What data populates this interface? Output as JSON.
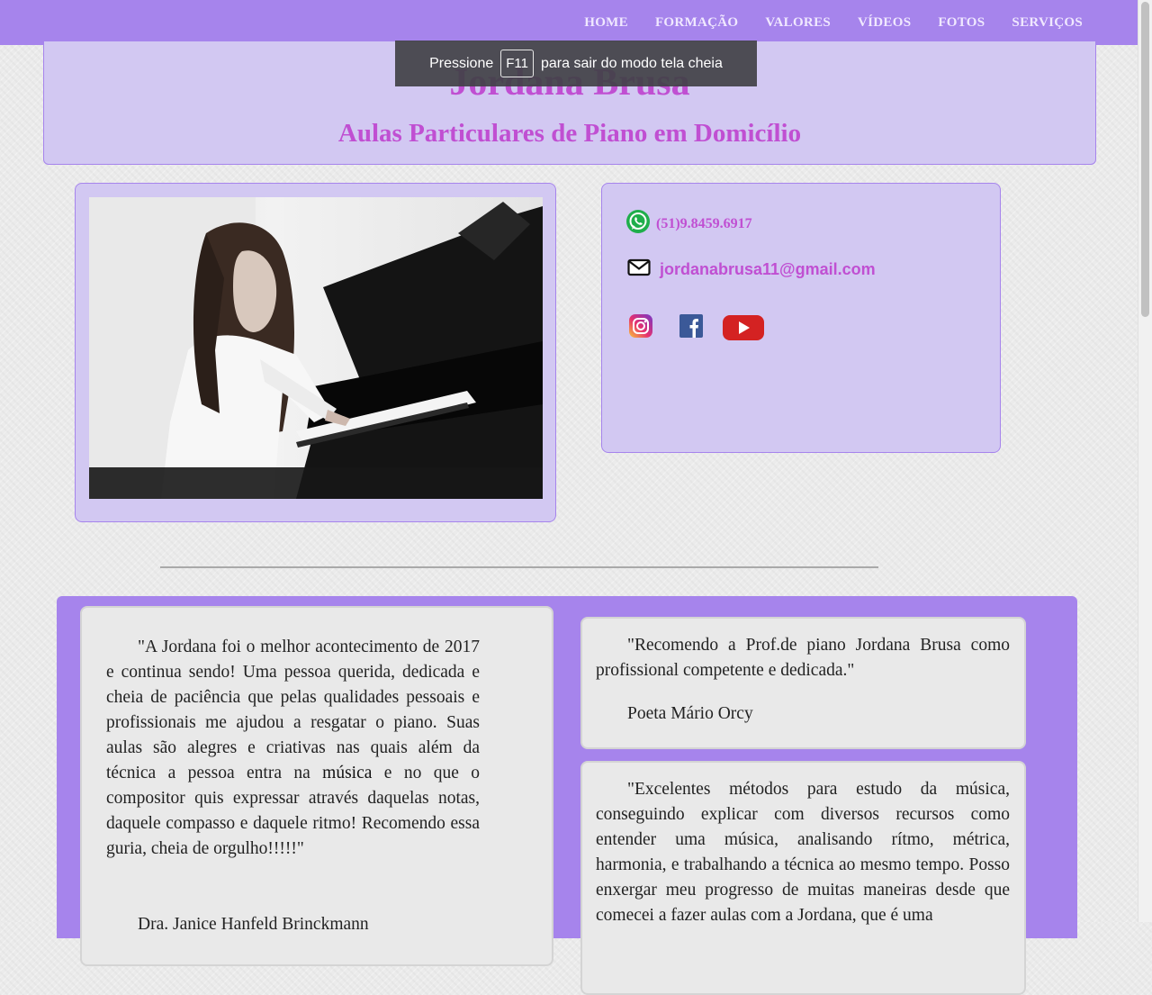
{
  "nav": {
    "items": [
      {
        "label": "HOME"
      },
      {
        "label": "FORMAÇÃO"
      },
      {
        "label": "VALORES"
      },
      {
        "label": "VÍDEOS"
      },
      {
        "label": "FOTOS"
      },
      {
        "label": "SERVIÇOS"
      }
    ]
  },
  "header": {
    "title": "Jordana Brusa",
    "subtitle": "Aulas Particulares de Piano em Domicílio"
  },
  "fullscreen_notice": {
    "prefix": "Pressione",
    "key": "F11",
    "suffix": "para sair do modo tela cheia"
  },
  "contact": {
    "phone": "(51)9.8459.6917",
    "email": "jordanabrusa11@gmail.com",
    "social": [
      "instagram-icon",
      "facebook-icon",
      "youtube-icon"
    ]
  },
  "testimonials": [
    {
      "text_before": "\"A Jordana foi o melhor acontecimento de 2017 e continua sendo! Uma pessoa querida, dedicada e cheia de paciência que pelas qualidades pessoais e profissionais me ajudou a resgatar o piano. Suas aulas são alegres e criativas nas quais além da técnica a pessoa entra na ",
      "link": "música",
      "text_after": " e no que o compositor quis expressar através daquelas notas, daquele compasso e daquele ritmo! Recomendo essa guria, cheia de orgulho!!!!!\"",
      "author": "Dra. Janice Hanfeld Brinckmann"
    },
    {
      "text": "\"Recomendo a Prof.de piano Jordana Brusa como profissional competente e dedicada.\"",
      "author": "Poeta Mário Orcy"
    },
    {
      "text": "\"Excelentes métodos para estudo da música, conseguindo explicar com diversos recursos como entender uma música, analisando rítmo, métrica, harmonia, e trabalhando a técnica ao mesmo tempo. Posso enxergar meu progresso de muitas maneiras desde que comecei a fazer aulas com a Jordana, que é uma"
    }
  ],
  "colors": {
    "nav_bg": "#a684ec",
    "panel_bg": "#d2c8f2",
    "accent_text": "#c04fd2"
  }
}
